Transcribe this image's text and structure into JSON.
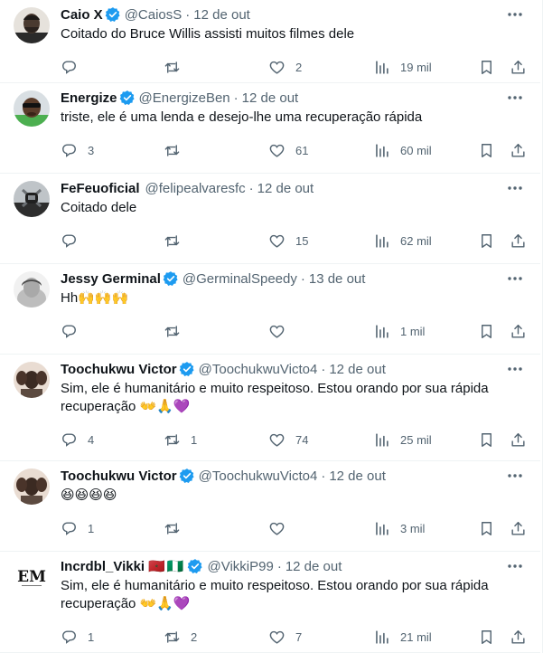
{
  "tweets": [
    {
      "name": "Caio X",
      "verified": true,
      "handle": "@CaiosS",
      "date": "12 de out",
      "text": "Coitado do Bruce Willis assisti muitos filmes dele",
      "replies": "",
      "retweets": "",
      "likes": "2",
      "views": "19 mil",
      "avatar": "dark-man"
    },
    {
      "name": "Energize",
      "verified": true,
      "handle": "@EnergizeBen",
      "date": "12 de out",
      "text": "triste, ele é uma lenda e desejo-lhe uma recuperação rápida",
      "replies": "3",
      "retweets": "",
      "likes": "61",
      "views": "60 mil",
      "avatar": "green-sunglasses"
    },
    {
      "name": "FeFeuoficial",
      "verified": false,
      "handle": "@felipealvaresfc",
      "date": "12 de out",
      "text": "Coitado dele",
      "replies": "",
      "retweets": "",
      "likes": "15",
      "views": "62 mil",
      "avatar": "raiders-logo"
    },
    {
      "name": "Jessy Germinal",
      "verified": true,
      "handle": "@GerminalSpeedy",
      "date": "13 de out",
      "text": "Hh🙌🙌🙌",
      "replies": "",
      "retweets": "",
      "likes": "",
      "views": "1 mil",
      "avatar": "woman-bw"
    },
    {
      "name": "Toochukwu Victor",
      "verified": true,
      "handle": "@ToochukwuVicto4",
      "date": "12 de out",
      "text": "Sim, ele é humanitário e muito respeitoso. Estou orando por sua rápida recuperação 👐🙏💜",
      "replies": "4",
      "retweets": "1",
      "likes": "74",
      "views": "25 mil",
      "avatar": "man-hands"
    },
    {
      "name": "Toochukwu Victor",
      "verified": true,
      "handle": "@ToochukwuVicto4",
      "date": "12 de out",
      "text": "😆😆😆😆",
      "replies": "1",
      "retweets": "",
      "likes": "",
      "views": "3 mil",
      "avatar": "man-hands"
    },
    {
      "name": "Incrdbl_Vikki",
      "verified": true,
      "handle": "@VikkiP99",
      "date": "12 de out",
      "text": "Sim, ele é humanitário e muito respeitoso. Estou orando por sua rápida recuperação 👐🙏💜",
      "replies": "1",
      "retweets": "2",
      "likes": "7",
      "views": "21 mil",
      "avatar": "em-logo",
      "flags": [
        "🇲🇦",
        "🇳🇬"
      ]
    }
  ],
  "colors": {
    "text": "#0f1419",
    "muted": "#536471",
    "verified": "#1d9bf0",
    "divider": "#eff3f4"
  }
}
